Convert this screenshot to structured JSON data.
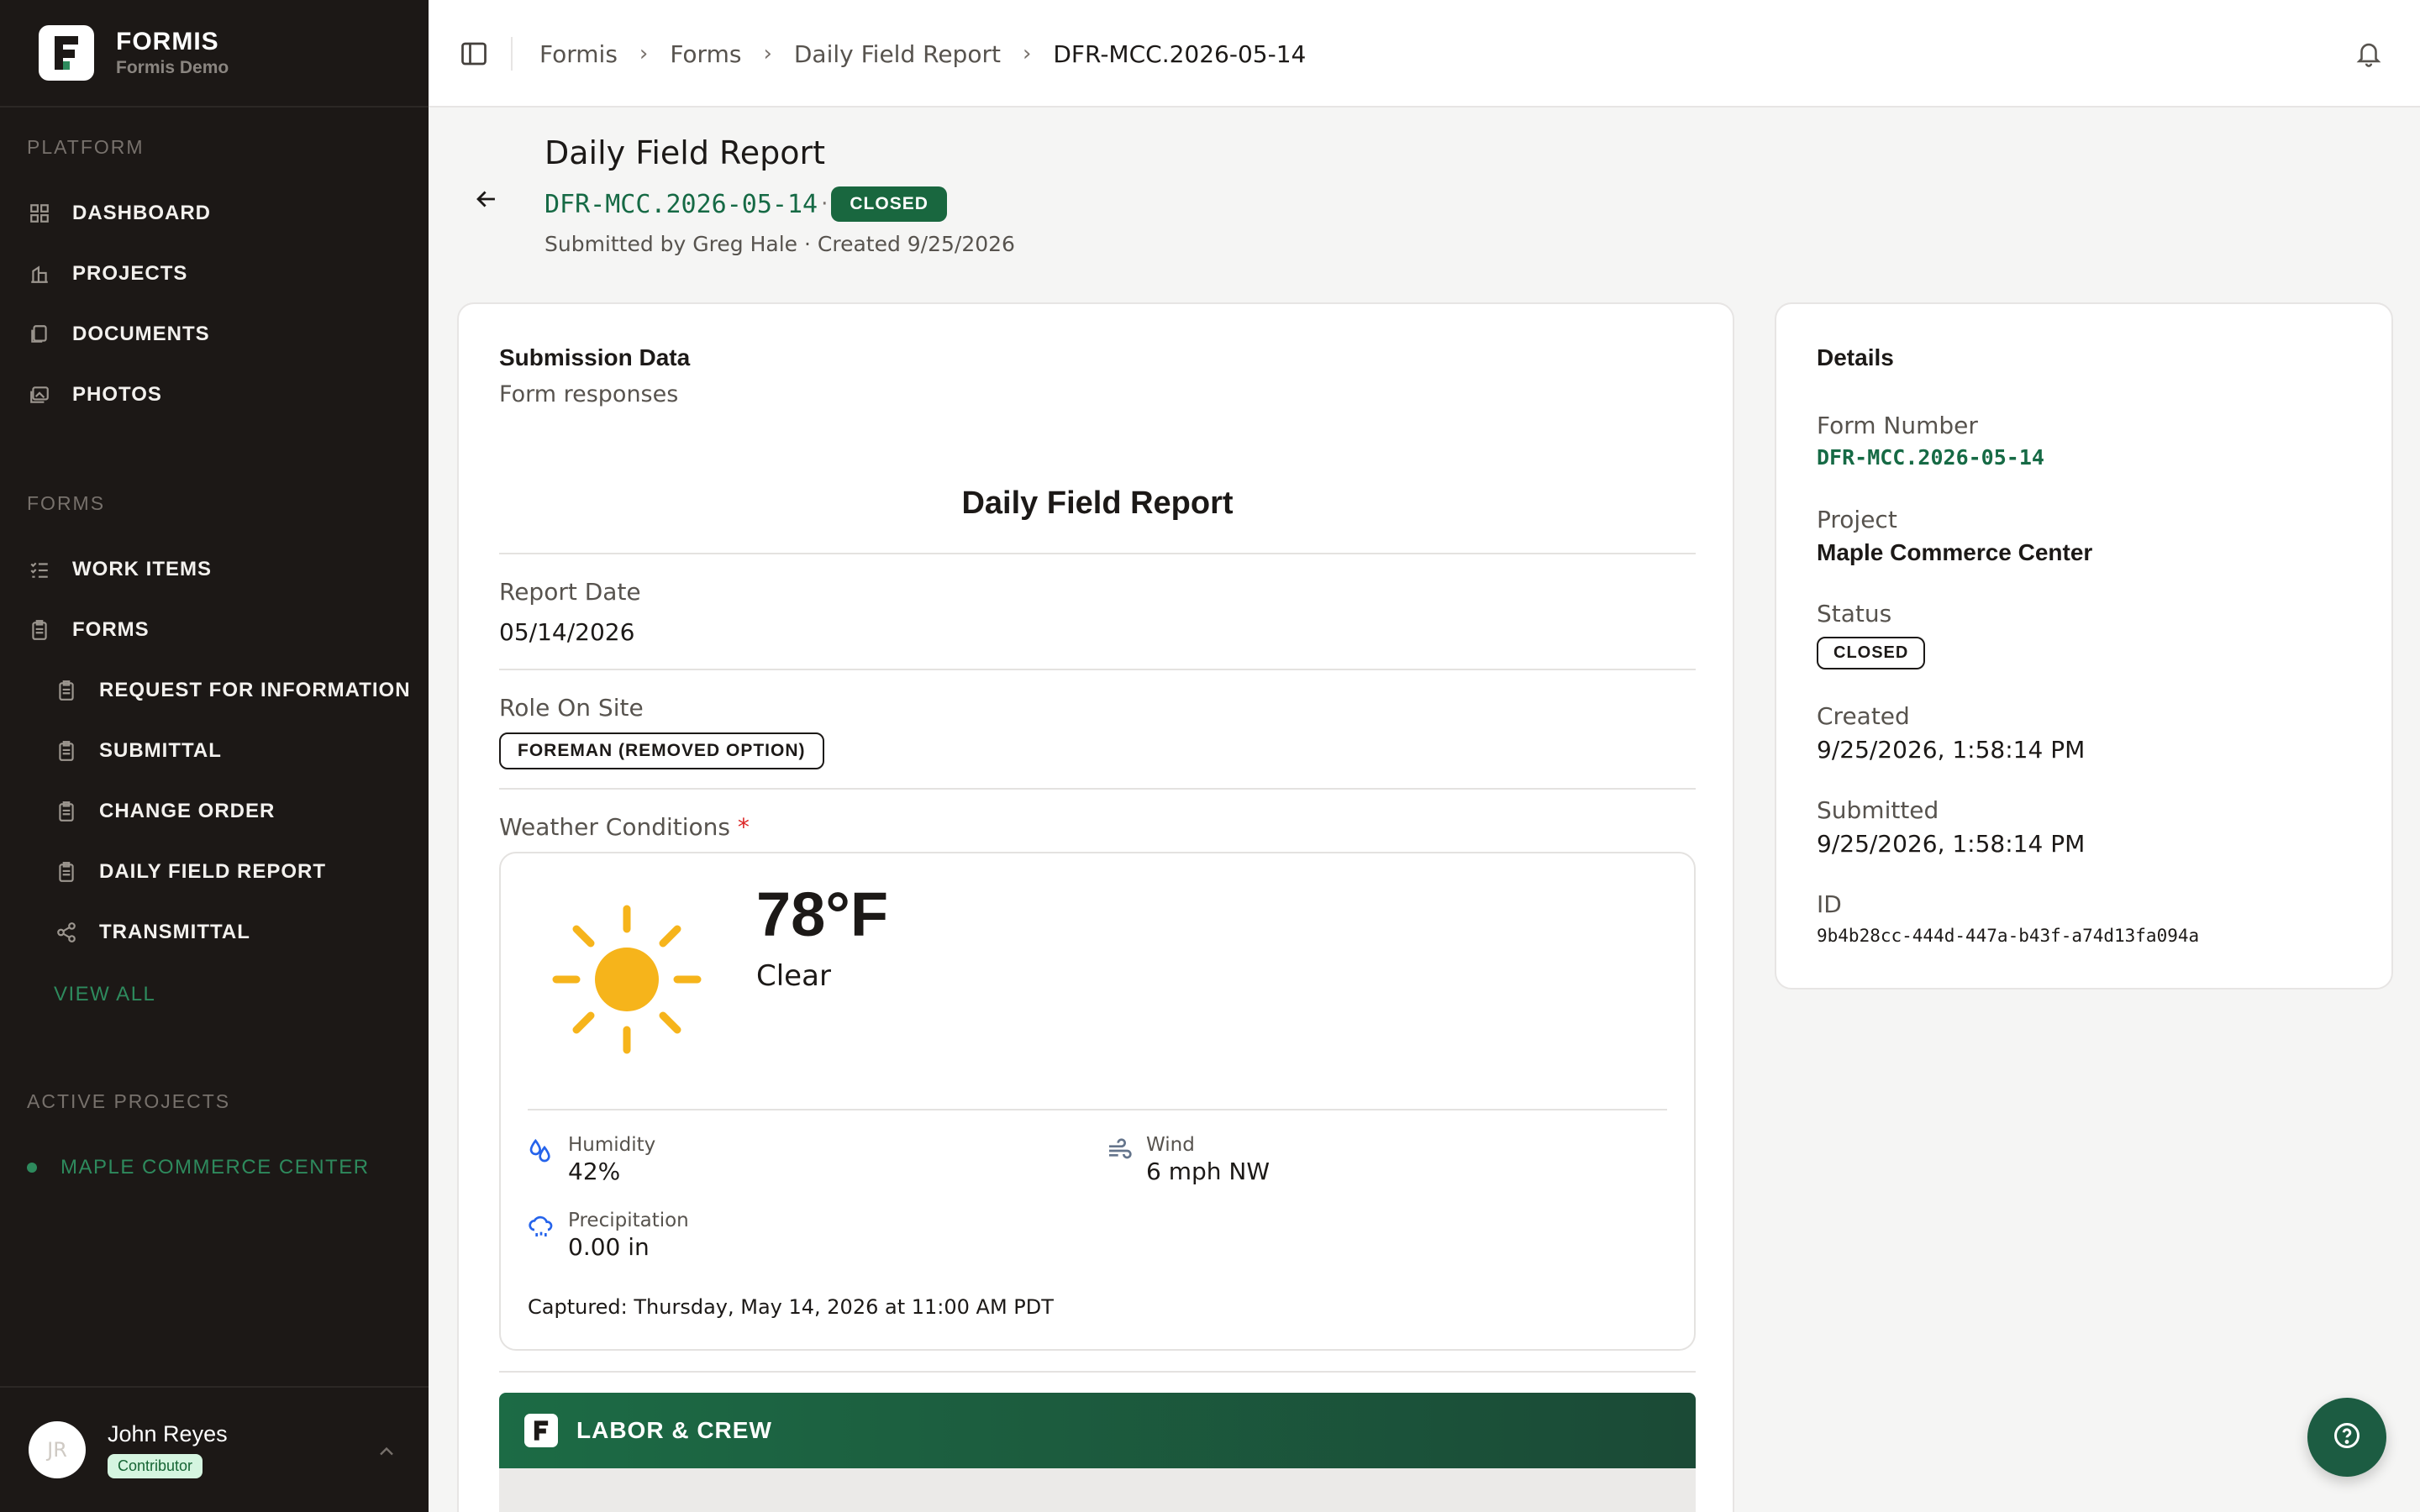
{
  "brand": {
    "name": "FORMIS",
    "subtitle": "Formis Demo"
  },
  "sidebar": {
    "platform_label": "PLATFORM",
    "platform_items": [
      {
        "label": "DASHBOARD",
        "icon": "grid-icon"
      },
      {
        "label": "PROJECTS",
        "icon": "building-icon"
      },
      {
        "label": "DOCUMENTS",
        "icon": "documents-icon"
      },
      {
        "label": "PHOTOS",
        "icon": "photos-icon"
      }
    ],
    "forms_label": "FORMS",
    "form_items": [
      {
        "label": "WORK ITEMS",
        "icon": "list-check-icon"
      },
      {
        "label": "FORMS",
        "icon": "clipboard-icon"
      }
    ],
    "form_sub_items": [
      {
        "label": "REQUEST FOR INFORMATION",
        "icon": "clipboard-icon"
      },
      {
        "label": "SUBMITTAL",
        "icon": "clipboard-icon"
      },
      {
        "label": "CHANGE ORDER",
        "icon": "clipboard-icon"
      },
      {
        "label": "DAILY FIELD REPORT",
        "icon": "clipboard-icon"
      },
      {
        "label": "TRANSMITTAL",
        "icon": "share-icon"
      }
    ],
    "view_all": "VIEW ALL",
    "active_projects_label": "ACTIVE PROJECTS",
    "active_projects": [
      "MAPLE COMMERCE CENTER"
    ]
  },
  "user": {
    "initials": "JR",
    "name": "John Reyes",
    "role": "Contributor"
  },
  "breadcrumbs": [
    "Formis",
    "Forms",
    "Daily Field Report",
    "DFR-MCC.2026-05-14"
  ],
  "header": {
    "title": "Daily Field Report",
    "form_number": "DFR-MCC.2026-05-14",
    "separator": "·",
    "status": "CLOSED",
    "meta": "Submitted by Greg Hale · Created 9/25/2026"
  },
  "submission": {
    "title": "Submission Data",
    "subtitle": "Form responses",
    "report_heading": "Daily Field Report",
    "report_date_label": "Report Date",
    "report_date_value": "05/14/2026",
    "role_label": "Role On Site",
    "role_value": "FOREMAN (REMOVED OPTION)",
    "weather_label": "Weather Conditions",
    "required_mark": "*",
    "weather": {
      "temperature": "78°F",
      "condition": "Clear",
      "humidity_label": "Humidity",
      "humidity_value": "42%",
      "wind_label": "Wind",
      "wind_value": "6 mph NW",
      "precip_label": "Precipitation",
      "precip_value": "0.00 in",
      "captured": "Captured: Thursday, May 14, 2026 at 11:00 AM PDT",
      "sun_color": "#f6b41b"
    },
    "section_banner": "LABOR & CREW"
  },
  "details": {
    "title": "Details",
    "form_number_label": "Form Number",
    "form_number_value": "DFR-MCC.2026-05-14",
    "project_label": "Project",
    "project_value": "Maple Commerce Center",
    "status_label": "Status",
    "status_value": "CLOSED",
    "created_label": "Created",
    "created_value": "9/25/2026, 1:58:14 PM",
    "submitted_label": "Submitted",
    "submitted_value": "9/25/2026, 1:58:14 PM",
    "id_label": "ID",
    "id_value": "9b4b28cc-444d-447a-b43f-a74d13fa094a"
  },
  "colors": {
    "sidebar_bg": "#1c1816",
    "accent_green": "#166a45",
    "status_closed_bg": "#19673f",
    "link_green": "#2e8a5d"
  }
}
